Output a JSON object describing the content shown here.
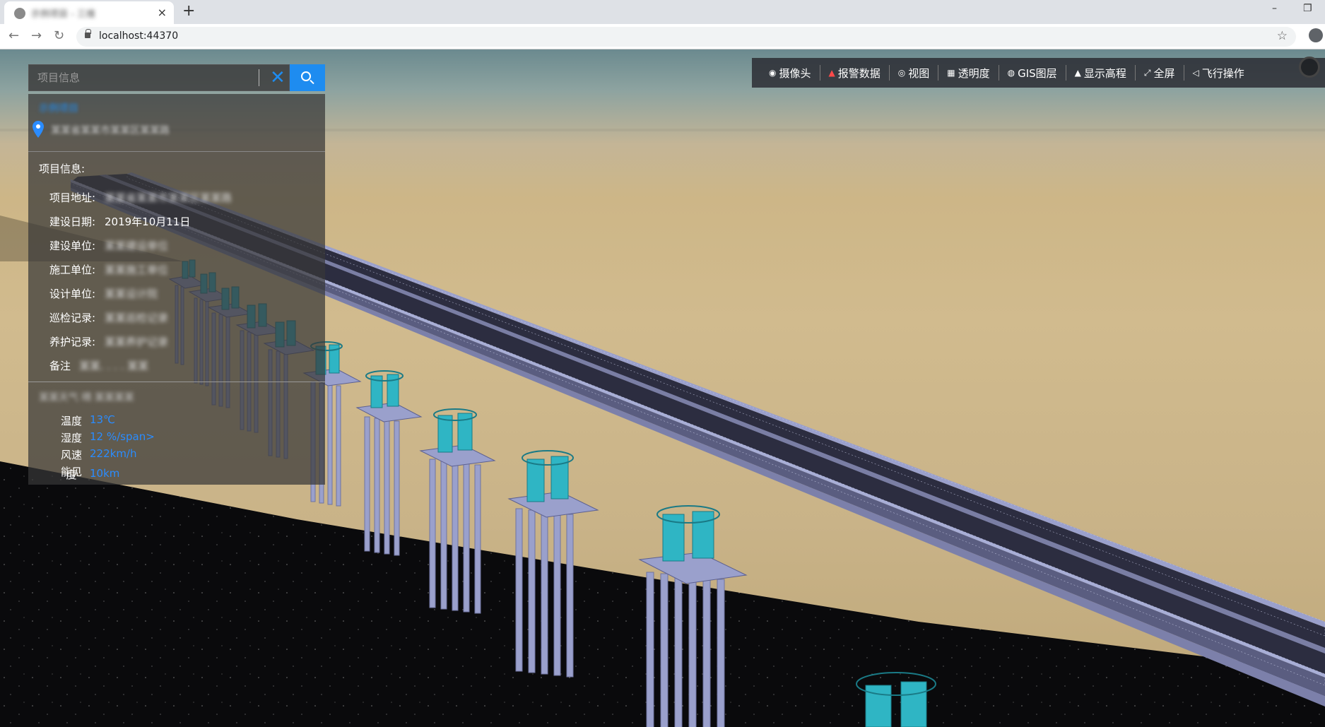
{
  "browser": {
    "tab_title": "示例项目 - 三维",
    "tab_close": "×",
    "new_tab": "+",
    "url": "localhost:44370",
    "minimize": "–",
    "restore": "❐"
  },
  "toolbar": {
    "items": [
      {
        "label": "摄像头",
        "icon": "camera-icon"
      },
      {
        "label": "报警数据",
        "icon": "alarm-icon"
      },
      {
        "label": "视图",
        "icon": "view-icon"
      },
      {
        "label": "透明度",
        "icon": "transparency-icon"
      },
      {
        "label": "GIS图层",
        "icon": "globe-icon"
      },
      {
        "label": "显示高程",
        "icon": "mountain-icon"
      },
      {
        "label": "全屏",
        "icon": "fullscreen-icon"
      },
      {
        "label": "飞行操作",
        "icon": "flight-icon"
      }
    ]
  },
  "search": {
    "placeholder": "项目信息",
    "clear_label": "✕"
  },
  "project": {
    "name": "示例项目",
    "location": "某某省某某市某某区某某路",
    "info_title": "项目信息:",
    "fields": [
      {
        "key": "项目地址:",
        "value": "某某省某某市某某区某某路",
        "blurred": true
      },
      {
        "key": "建设日期:",
        "value": "2019年10月11日",
        "blurred": false
      },
      {
        "key": "建设单位:",
        "value": "某某建设单位",
        "blurred": true
      },
      {
        "key": "施工单位:",
        "value": "某某施工单位",
        "blurred": true
      },
      {
        "key": "设计单位:",
        "value": "某某设计院",
        "blurred": true
      },
      {
        "key": "巡检记录:",
        "value": "某某巡检记录",
        "blurred": true
      },
      {
        "key": "养护记录:",
        "value": "某某养护记录",
        "blurred": true
      },
      {
        "key": "备注",
        "value": "某某. . . . 某某",
        "blurred": true
      }
    ]
  },
  "weather": {
    "header": "某某天气 晴 某某某某",
    "rows": [
      {
        "key": "温度",
        "value": "13℃"
      },
      {
        "key": "湿度",
        "value": "12 %/span>"
      },
      {
        "key": "风速",
        "value": "222km/h"
      },
      {
        "key": "能见",
        "value": ""
      },
      {
        "key": "度",
        "value": "10km"
      }
    ]
  },
  "colors": {
    "accent": "#1e8cf0",
    "value_blue": "#2a8cff",
    "pier_cyan": "#2fb5c4",
    "deck_dark": "#2c2d40",
    "pile_lavender": "#9aa0cc"
  }
}
